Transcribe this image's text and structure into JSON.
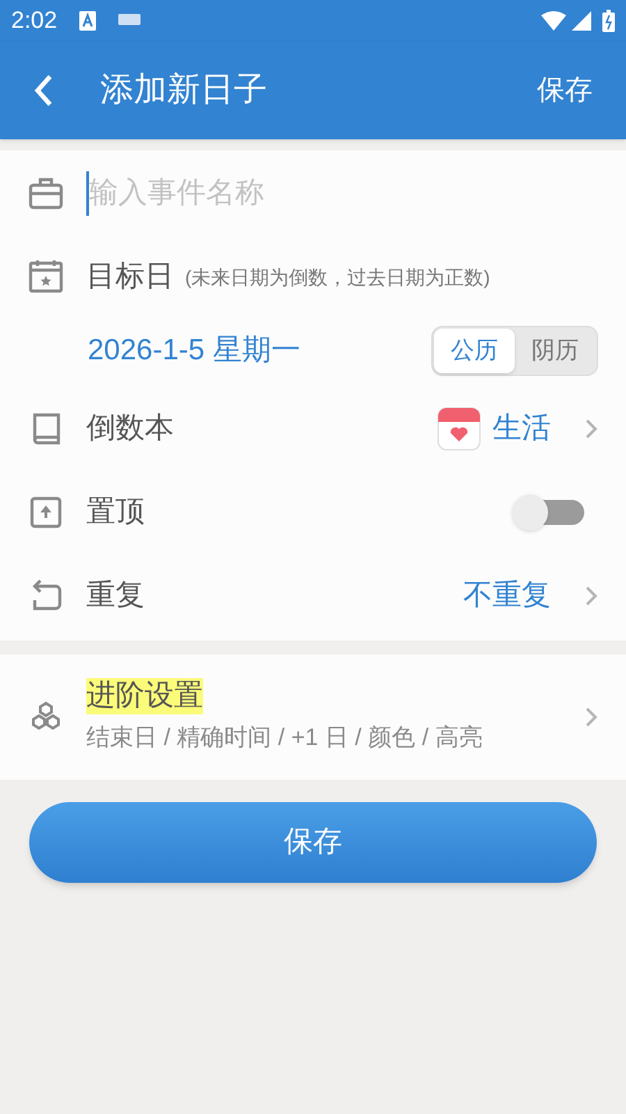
{
  "status_bar": {
    "time": "2:02"
  },
  "app_bar": {
    "title": "添加新日子",
    "action": "保存"
  },
  "name_field": {
    "placeholder": "输入事件名称"
  },
  "target_date": {
    "label": "目标日",
    "hint": "(未来日期为倒数，过去日期为正数)",
    "date": "2026-1-5 星期一",
    "calendars": [
      {
        "label": "公历",
        "selected": true
      },
      {
        "label": "阴历",
        "selected": false
      }
    ]
  },
  "notebook": {
    "label": "倒数本",
    "value": "生活"
  },
  "pin": {
    "label": "置顶",
    "on": false
  },
  "repeat": {
    "label": "重复",
    "value": "不重复"
  },
  "advanced": {
    "title": "进阶设置",
    "subtitle": "结束日 / 精确时间 / +1 日 / 颜色 / 高亮"
  },
  "save_button": "保存"
}
